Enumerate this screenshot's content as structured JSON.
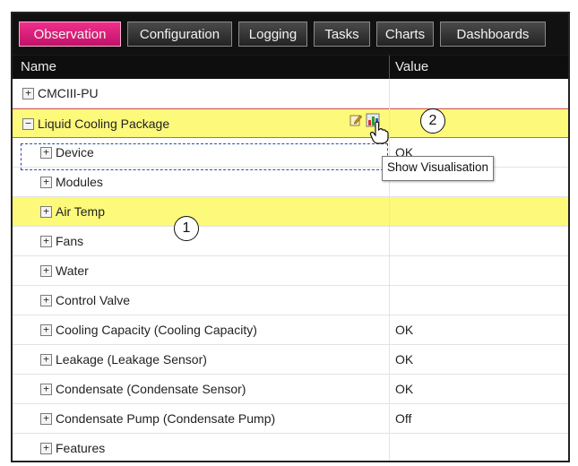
{
  "tabs": [
    {
      "label": "Observation",
      "active": true
    },
    {
      "label": "Configuration",
      "active": false
    },
    {
      "label": "Logging",
      "active": false
    },
    {
      "label": "Tasks",
      "active": false
    },
    {
      "label": "Charts",
      "active": false
    },
    {
      "label": "Dashboards",
      "active": false
    }
  ],
  "columns": {
    "name": "Name",
    "value": "Value"
  },
  "rows": [
    {
      "label": "CMCIII-PU",
      "value": "",
      "toggle": "+"
    },
    {
      "label": "Liquid Cooling Package",
      "value": "",
      "toggle": "−"
    },
    {
      "label": "Device",
      "value": "OK",
      "toggle": "+"
    },
    {
      "label": "Modules",
      "value": "",
      "toggle": "+"
    },
    {
      "label": "Air Temp",
      "value": "",
      "toggle": "+"
    },
    {
      "label": "Fans",
      "value": "",
      "toggle": "+"
    },
    {
      "label": "Water",
      "value": "",
      "toggle": "+"
    },
    {
      "label": "Control Valve",
      "value": "",
      "toggle": "+"
    },
    {
      "label": "Cooling Capacity (Cooling Capacity)",
      "value": "OK",
      "toggle": "+"
    },
    {
      "label": "Leakage (Leakage Sensor)",
      "value": "OK",
      "toggle": "+"
    },
    {
      "label": "Condensate (Condensate Sensor)",
      "value": "OK",
      "toggle": "+"
    },
    {
      "label": "Condensate Pump (Condensate Pump)",
      "value": "Off",
      "toggle": "+"
    },
    {
      "label": "Features",
      "value": "",
      "toggle": "+"
    }
  ],
  "tooltip": "Show Visualisation",
  "callouts": [
    "1",
    "2"
  ],
  "icons": {
    "edit": "edit-icon",
    "chart": "chart-icon",
    "cursor": "hand-cursor-icon"
  },
  "colors": {
    "active_tab": "#d81b78",
    "highlight_row": "#fdf97a",
    "selection_border": "#e25555"
  }
}
